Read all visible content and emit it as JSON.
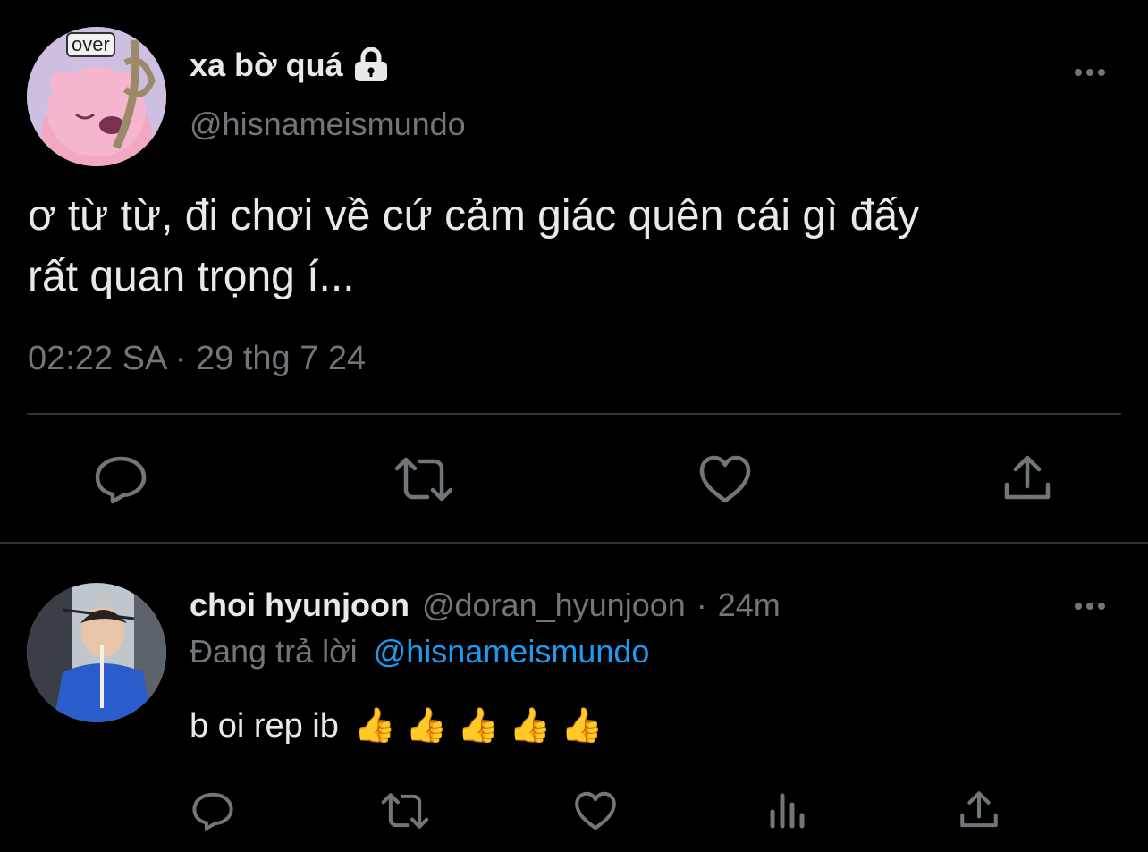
{
  "main_tweet": {
    "display_name": "xa bờ quá",
    "lock_icon": "lock-icon",
    "handle": "@hisnameismundo",
    "avatar_badge_text": "over",
    "text_line1": "ơ từ từ, đi chơi về cứ cảm giác quên cái gì đấy",
    "text_line2": "rất quan trọng í...",
    "timestamp": "02:22 SA · 29 thg 7 24",
    "actions": [
      "reply-icon",
      "retweet-icon",
      "like-icon",
      "share-icon"
    ]
  },
  "reply": {
    "display_name": "choi hyunjoon",
    "handle": "@doran_hyunjoon",
    "sep": "·",
    "time": "24m",
    "replying_prefix": "Đang trả lời",
    "replying_to": "@hisnameismundo",
    "text": "b oi rep ib",
    "emojis": "👍 👍 👍 👍 👍",
    "actions": [
      "reply-icon",
      "retweet-icon",
      "like-icon",
      "analytics-icon",
      "share-icon"
    ]
  },
  "colors": {
    "background": "#000000",
    "text": "#e7e9ea",
    "secondary": "#71767b",
    "link": "#1d9bf0",
    "divider": "#2f3336"
  }
}
